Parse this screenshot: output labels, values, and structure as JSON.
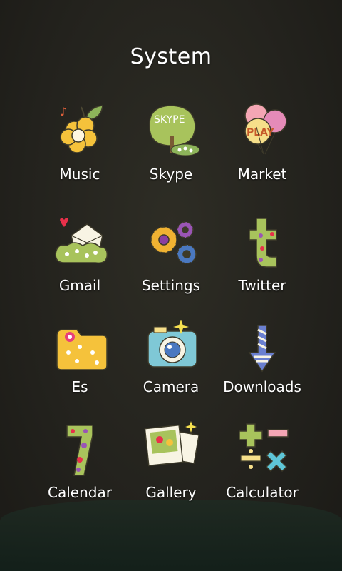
{
  "folder": {
    "title": "System"
  },
  "apps": [
    {
      "label": "Music",
      "icon": "music-icon"
    },
    {
      "label": "Skype",
      "icon": "skype-icon",
      "icon_text": "SKYPE"
    },
    {
      "label": "Market",
      "icon": "market-icon",
      "icon_text": "PLAY"
    },
    {
      "label": "Gmail",
      "icon": "gmail-icon"
    },
    {
      "label": "Settings",
      "icon": "settings-icon"
    },
    {
      "label": "Twitter",
      "icon": "twitter-icon"
    },
    {
      "label": "Es",
      "icon": "es-folder-icon"
    },
    {
      "label": "Camera",
      "icon": "camera-icon"
    },
    {
      "label": "Downloads",
      "icon": "downloads-icon"
    },
    {
      "label": "Calendar",
      "icon": "calendar-icon"
    },
    {
      "label": "Gallery",
      "icon": "gallery-icon"
    },
    {
      "label": "Calculator",
      "icon": "calculator-icon"
    }
  ]
}
